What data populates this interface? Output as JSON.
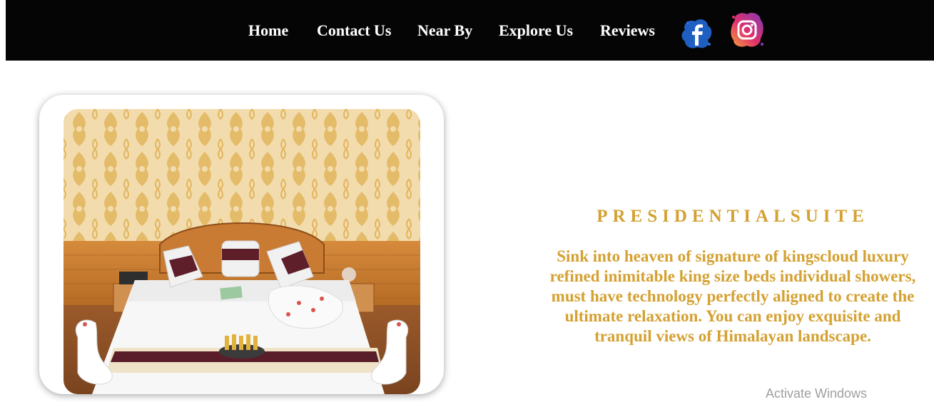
{
  "nav": {
    "items": [
      {
        "label": "Home"
      },
      {
        "label": "Contact Us"
      },
      {
        "label": "Near By"
      },
      {
        "label": "Explore Us"
      },
      {
        "label": "Reviews"
      }
    ],
    "social": [
      {
        "icon": "facebook-icon",
        "color": "#1f5fc2"
      },
      {
        "icon": "instagram-icon",
        "color": "#c13584"
      }
    ]
  },
  "room": {
    "title": "PRESIDENTIALSUITE",
    "description": "Sink into heaven of signature of kingscloud luxury refined inimitable king size beds individual showers, must have technology perfectly aligned to create the ultimate relaxation. You can enjoy exquisite and tranquil views of Himalayan landscape.",
    "accent_color": "#d4a132"
  },
  "overlay": {
    "watermark": "Activate Windows"
  }
}
